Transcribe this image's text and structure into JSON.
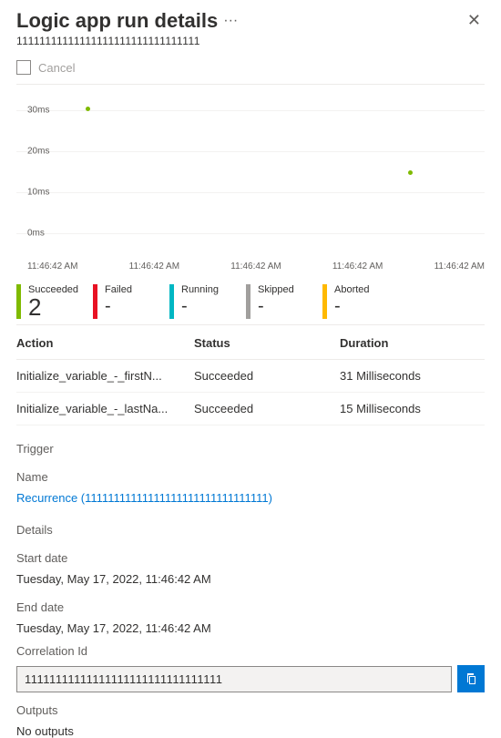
{
  "header": {
    "title": "Logic app run details",
    "run_id": "11111111111111111111111111111111",
    "cancel_label": "Cancel"
  },
  "chart_data": {
    "type": "scatter",
    "ylabel": "",
    "xlabel": "",
    "y_ticks": [
      "0ms",
      "10ms",
      "20ms",
      "30ms"
    ],
    "x_ticks": [
      "11:46:42 AM",
      "11:46:42 AM",
      "11:46:42 AM",
      "11:46:42 AM",
      "11:46:42 AM"
    ],
    "ylim": [
      0,
      30
    ],
    "points": [
      {
        "x_index": 0,
        "y_ms": 31
      },
      {
        "x_index": 3,
        "y_ms": 15
      }
    ]
  },
  "kpis": [
    {
      "label": "Succeeded",
      "value": "2",
      "color": "#7fba00"
    },
    {
      "label": "Failed",
      "value": "-",
      "color": "#e81123"
    },
    {
      "label": "Running",
      "value": "-",
      "color": "#00b7c3"
    },
    {
      "label": "Skipped",
      "value": "-",
      "color": "#a19f9d"
    },
    {
      "label": "Aborted",
      "value": "-",
      "color": "#ffb900"
    }
  ],
  "table": {
    "headers": {
      "action": "Action",
      "status": "Status",
      "duration": "Duration"
    },
    "rows": [
      {
        "action": "Initialize_variable_-_firstN...",
        "status": "Succeeded",
        "duration": "31 Milliseconds"
      },
      {
        "action": "Initialize_variable_-_lastNa...",
        "status": "Succeeded",
        "duration": "15 Milliseconds"
      }
    ]
  },
  "trigger": {
    "section": "Trigger",
    "name_label": "Name",
    "name_link": "Recurrence (11111111111111111111111111111111)"
  },
  "details": {
    "section": "Details",
    "start_label": "Start date",
    "start_value": "Tuesday, May 17, 2022, 11:46:42 AM",
    "end_label": "End date",
    "end_value": "Tuesday, May 17, 2022, 11:46:42 AM",
    "corr_label": "Correlation Id",
    "corr_value": "11111111111111111111111111111111"
  },
  "outputs": {
    "section": "Outputs",
    "value": "No outputs"
  }
}
